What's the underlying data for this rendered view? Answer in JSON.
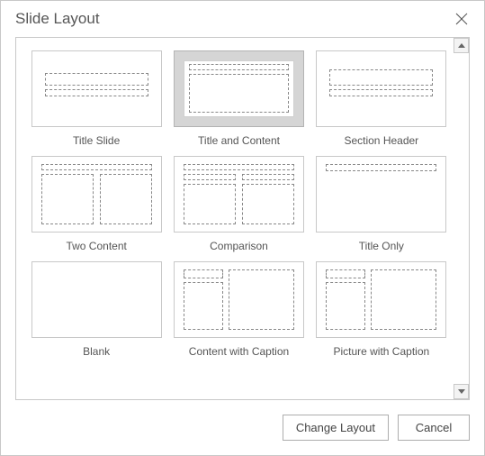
{
  "dialog": {
    "title": "Slide Layout"
  },
  "layouts": [
    {
      "id": "title-slide",
      "label": "Title Slide"
    },
    {
      "id": "title-and-content",
      "label": "Title and Content"
    },
    {
      "id": "section-header",
      "label": "Section Header"
    },
    {
      "id": "two-content",
      "label": "Two Content"
    },
    {
      "id": "comparison",
      "label": "Comparison"
    },
    {
      "id": "title-only",
      "label": "Title Only"
    },
    {
      "id": "blank",
      "label": "Blank"
    },
    {
      "id": "content-with-caption",
      "label": "Content with Caption"
    },
    {
      "id": "picture-with-caption",
      "label": "Picture with Caption"
    }
  ],
  "selected": "title-and-content",
  "buttons": {
    "change": "Change Layout",
    "cancel": "Cancel"
  }
}
